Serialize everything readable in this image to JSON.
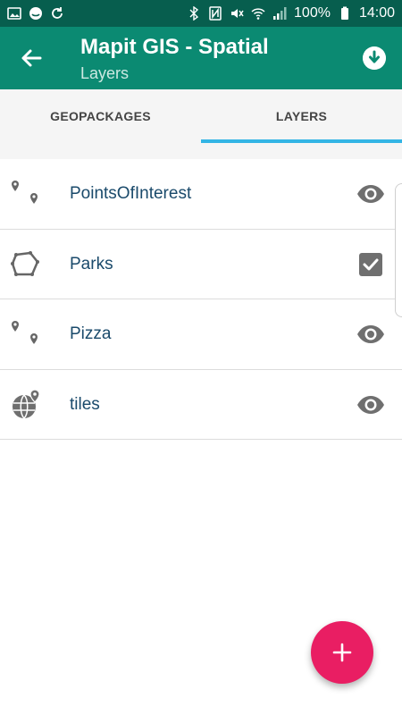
{
  "status_bar": {
    "battery": "100%",
    "time": "14:00",
    "left_icons": [
      "gallery-icon",
      "messenger-icon",
      "sync-icon"
    ],
    "right_icons": [
      "bluetooth-icon",
      "nfc-icon",
      "mute-icon",
      "wifi-icon",
      "signal-icon",
      "battery-icon"
    ]
  },
  "app_bar": {
    "title": "Mapit GIS - Spatial",
    "subtitle": "Layers",
    "color": "#0b8a72"
  },
  "tabs": [
    {
      "label": "GEOPACKAGES",
      "selected": false
    },
    {
      "label": "LAYERS",
      "selected": true
    }
  ],
  "layers": [
    {
      "name": "PointsOfInterest",
      "icon": "points-icon",
      "action": "eye-icon"
    },
    {
      "name": "Parks",
      "icon": "polygon-icon",
      "action": "checkbox-checked-icon"
    },
    {
      "name": "Pizza",
      "icon": "points-icon",
      "action": "eye-icon"
    },
    {
      "name": "tiles",
      "icon": "globe-pin-icon",
      "action": "eye-icon"
    }
  ],
  "fab": {
    "icon": "plus-icon",
    "color": "#e91e63"
  },
  "accent_color": "#33b5e5"
}
